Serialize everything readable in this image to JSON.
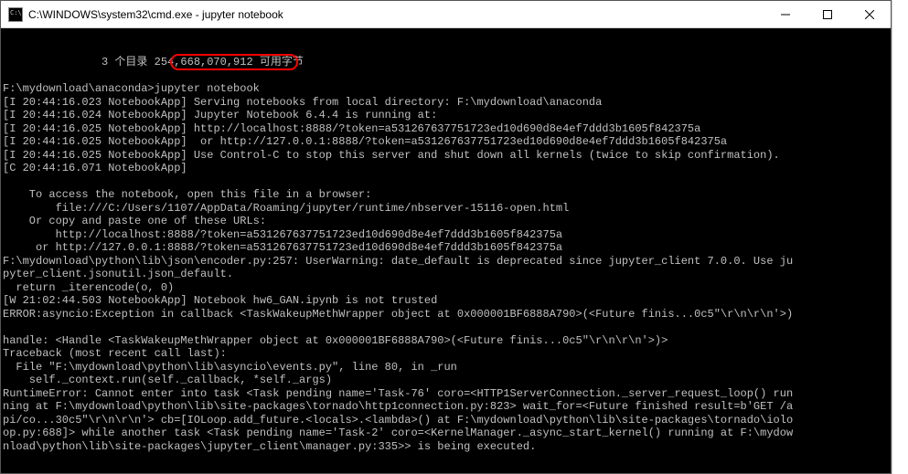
{
  "window": {
    "title": "C:\\WINDOWS\\system32\\cmd.exe - jupyter  notebook"
  },
  "annotation": {
    "highlighted_command": "jupyter notebook"
  },
  "terminal": {
    "lines": [
      "               3 个目录 254,668,070,912 可用字节",
      "",
      "F:\\mydownload\\anaconda>jupyter notebook",
      "[I 20:44:16.023 NotebookApp] Serving notebooks from local directory: F:\\mydownload\\anaconda",
      "[I 20:44:16.024 NotebookApp] Jupyter Notebook 6.4.4 is running at:",
      "[I 20:44:16.025 NotebookApp] http://localhost:8888/?token=a531267637751723ed10d690d8e4ef7ddd3b1605f842375a",
      "[I 20:44:16.025 NotebookApp]  or http://127.0.0.1:8888/?token=a531267637751723ed10d690d8e4ef7ddd3b1605f842375a",
      "[I 20:44:16.025 NotebookApp] Use Control-C to stop this server and shut down all kernels (twice to skip confirmation).",
      "[C 20:44:16.071 NotebookApp]",
      "",
      "    To access the notebook, open this file in a browser:",
      "        file:///C:/Users/1107/AppData/Roaming/jupyter/runtime/nbserver-15116-open.html",
      "    Or copy and paste one of these URLs:",
      "        http://localhost:8888/?token=a531267637751723ed10d690d8e4ef7ddd3b1605f842375a",
      "     or http://127.0.0.1:8888/?token=a531267637751723ed10d690d8e4ef7ddd3b1605f842375a",
      "F:\\mydownload\\python\\lib\\json\\encoder.py:257: UserWarning: date_default is deprecated since jupyter_client 7.0.0. Use ju",
      "pyter_client.jsonutil.json_default.",
      "  return _iterencode(o, 0)",
      "[W 21:02:44.503 NotebookApp] Notebook hw6_GAN.ipynb is not trusted",
      "ERROR:asyncio:Exception in callback <TaskWakeupMethWrapper object at 0x000001BF6888A790>(<Future finis...0c5\"\\r\\n\\r\\n'>)",
      "",
      "handle: <Handle <TaskWakeupMethWrapper object at 0x000001BF6888A790>(<Future finis...0c5\"\\r\\n\\r\\n'>)>",
      "Traceback (most recent call last):",
      "  File \"F:\\mydownload\\python\\lib\\asyncio\\events.py\", line 80, in _run",
      "    self._context.run(self._callback, *self._args)",
      "RuntimeError: Cannot enter into task <Task pending name='Task-76' coro=<HTTP1ServerConnection._server_request_loop() run",
      "ning at F:\\mydownload\\python\\lib\\site-packages\\tornado\\http1connection.py:823> wait_for=<Future finished result=b'GET /a",
      "pi/co...30c5\"\\r\\n\\r\\n'> cb=[IOLoop.add_future.<locals>.<lambda>() at F:\\mydownload\\python\\lib\\site-packages\\tornado\\iolo",
      "op.py:688]> while another task <Task pending name='Task-2' coro=<KernelManager._async_start_kernel() running at F:\\mydow",
      "nload\\python\\lib\\site-packages\\jupyter_client\\manager.py:335>> is being executed."
    ]
  }
}
